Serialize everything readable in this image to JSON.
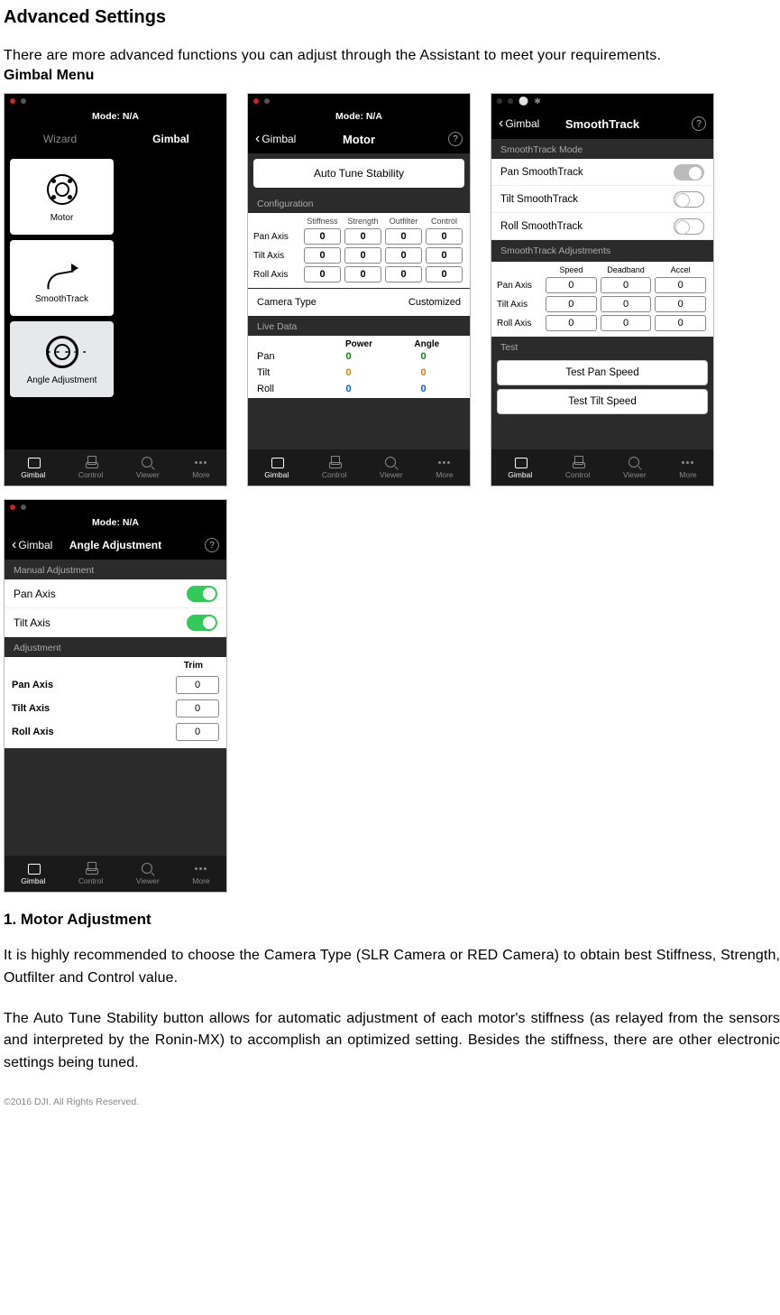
{
  "doc": {
    "title": "Advanced Settings",
    "intro": "There are more advanced functions you can adjust through the Assistant to meet your requirements.",
    "gimbal_menu_heading": "Gimbal Menu",
    "section1_heading": "1. Motor Adjustment",
    "para1": "It is highly recommended to choose the Camera Type (SLR Camera or RED Camera) to obtain best Stiffness, Strength, Outfilter and Control value.",
    "para2": "The Auto Tune Stability button allows for automatic adjustment of each motor's stiffness (as relayed from the sensors and interpreted by the Ronin-MX) to accomplish an optimized setting. Besides the stiffness, there are other electronic settings being tuned.",
    "footer": "©2016 DJI. All Rights Reserved."
  },
  "common": {
    "mode_label": "Mode: N/A",
    "tabs": {
      "gimbal": "Gimbal",
      "control": "Control",
      "viewer": "Viewer",
      "more": "More"
    },
    "help": "?"
  },
  "screen_gimbal": {
    "seg_wizard": "Wizard",
    "seg_gimbal": "Gimbal",
    "card_motor": "Motor",
    "card_smooth": "SmoothTrack",
    "card_angle": "Angle Adjustment"
  },
  "screen_motor": {
    "back": "Gimbal",
    "title": "Motor",
    "auto_tune": "Auto Tune Stability",
    "config_label": "Configuration",
    "cols": {
      "stiffness": "Stiffness",
      "strength": "Strength",
      "outfilter": "Outfilter",
      "control": "Control"
    },
    "rows": {
      "pan": {
        "label": "Pan Axis",
        "stiffness": "0",
        "strength": "0",
        "outfilter": "0",
        "control": "0"
      },
      "tilt": {
        "label": "Tilt Axis",
        "stiffness": "0",
        "strength": "0",
        "outfilter": "0",
        "control": "0"
      },
      "roll": {
        "label": "Roll Axis",
        "stiffness": "0",
        "strength": "0",
        "outfilter": "0",
        "control": "0"
      }
    },
    "camera_type_label": "Camera Type",
    "camera_type_value": "Customized",
    "live_label": "Live Data",
    "live_cols": {
      "power": "Power",
      "angle": "Angle"
    },
    "live": {
      "pan": {
        "label": "Pan",
        "power": "0",
        "angle": "0"
      },
      "tilt": {
        "label": "Tilt",
        "power": "0",
        "angle": "0"
      },
      "roll": {
        "label": "Roll",
        "power": "0",
        "angle": "0"
      }
    }
  },
  "screen_smooth": {
    "back": "Gimbal",
    "title": "SmoothTrack",
    "mode_label": "SmoothTrack Mode",
    "modes": {
      "pan": "Pan SmoothTrack",
      "tilt": "Tilt SmoothTrack",
      "roll": "Roll SmoothTrack"
    },
    "adjust_label": "SmoothTrack Adjustments",
    "cols": {
      "speed": "Speed",
      "deadband": "Deadband",
      "accel": "Accel"
    },
    "rows": {
      "pan": {
        "label": "Pan Axis",
        "speed": "0",
        "deadband": "0",
        "accel": "0"
      },
      "tilt": {
        "label": "Tilt Axis",
        "speed": "0",
        "deadband": "0",
        "accel": "0"
      },
      "roll": {
        "label": "Roll Axis",
        "speed": "0",
        "deadband": "0",
        "accel": "0"
      }
    },
    "test_label": "Test",
    "test_pan": "Test Pan Speed",
    "test_tilt": "Test Tilt Speed"
  },
  "screen_angle": {
    "back": "Gimbal",
    "title": "Angle Adjustment",
    "manual_label": "Manual Adjustment",
    "manual": {
      "pan": "Pan Axis",
      "tilt": "Tilt Axis"
    },
    "adjust_label": "Adjustment",
    "trim_col": "Trim",
    "rows": {
      "pan": {
        "label": "Pan Axis",
        "trim": "0"
      },
      "tilt": {
        "label": "Tilt Axis",
        "trim": "0"
      },
      "roll": {
        "label": "Roll Axis",
        "trim": "0"
      }
    }
  }
}
